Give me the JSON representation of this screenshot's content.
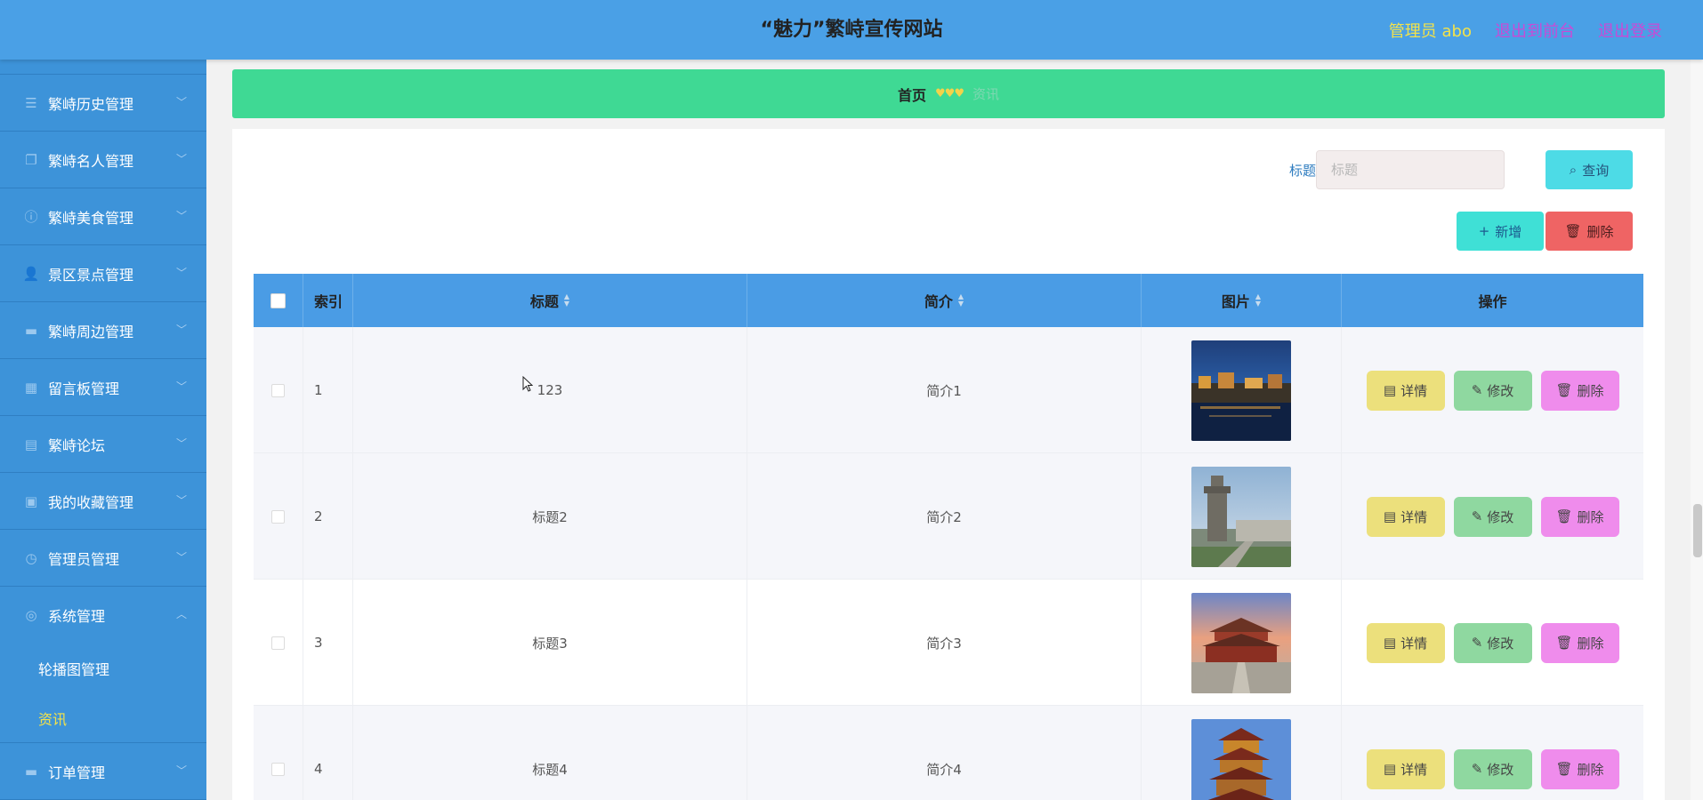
{
  "header": {
    "title": "“魅力”繁峙宣传网站",
    "user": "管理员 abo",
    "front_link": "退出到前台",
    "logout_link": "退出登录"
  },
  "sidebar": {
    "items": [
      {
        "label": "繁峙历史管理",
        "icon": "list-icon"
      },
      {
        "label": "繁峙名人管理",
        "icon": "copy-icon"
      },
      {
        "label": "繁峙美食管理",
        "icon": "info-icon"
      },
      {
        "label": "景区景点管理",
        "icon": "user-icon"
      },
      {
        "label": "繁峙周边管理",
        "icon": "monitor-icon"
      },
      {
        "label": "留言板管理",
        "icon": "building-icon"
      },
      {
        "label": "繁峙论坛",
        "icon": "clipboard-icon"
      },
      {
        "label": "我的收藏管理",
        "icon": "inbox-icon"
      },
      {
        "label": "管理员管理",
        "icon": "clock-icon"
      },
      {
        "label": "系统管理",
        "icon": "gear-icon"
      }
    ],
    "sub_items": [
      {
        "label": "轮播图管理"
      },
      {
        "label": "资讯"
      }
    ],
    "last_item": {
      "label": "订单管理",
      "icon": "monitor-icon"
    }
  },
  "breadcrumb": {
    "home": "首页",
    "current": "资讯"
  },
  "search": {
    "label": "标题",
    "placeholder": "标题",
    "button": "查询"
  },
  "actions": {
    "add": "新增",
    "delete": "删除"
  },
  "table": {
    "headers": {
      "index": "索引",
      "title": "标题",
      "intro": "简介",
      "image": "图片",
      "ops": "操作"
    },
    "rows": [
      {
        "index": "1",
        "title": "123",
        "intro": "简介1"
      },
      {
        "index": "2",
        "title": "标题2",
        "intro": "简介2"
      },
      {
        "index": "3",
        "title": "标题3",
        "intro": "简介3"
      },
      {
        "index": "4",
        "title": "标题4",
        "intro": "简介4"
      }
    ],
    "ops": {
      "detail": "详情",
      "edit": "修改",
      "remove": "删除"
    }
  },
  "colors": {
    "header_bg": "#4aa0e6",
    "sidebar_bg": "#3d93d9",
    "breadcrumb_bg": "#3fd994",
    "accent_yellow": "#f3e24a",
    "link_purple": "#c94ad6"
  }
}
